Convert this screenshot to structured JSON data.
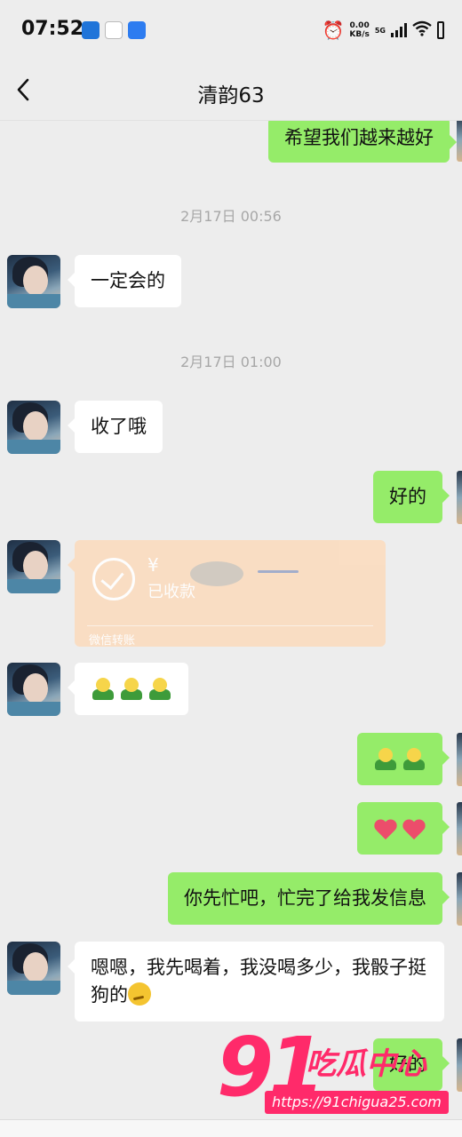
{
  "status_bar": {
    "time": "07:52",
    "net_speed_value": "0.00",
    "net_speed_unit": "KB/s",
    "network": "5G"
  },
  "nav": {
    "title": "清韵63"
  },
  "messages": {
    "m1": "希望我们越来越好",
    "stamp1": "2月17日 00:56",
    "m2": "一定会的",
    "stamp2": "2月17日 01:00",
    "m3": "收了哦",
    "m4": "好的",
    "transfer": {
      "amount": "¥",
      "status": "已收款",
      "footer": "微信转账"
    },
    "m9": "你先忙吧，忙完了给我发信息",
    "m10": "嗯嗯，我先喝着，我没喝多少，我骰子挺狗的",
    "m11": "好的"
  },
  "watermark": {
    "number": "91",
    "name": "吃瓜中心",
    "url": "https://91chigua25.com"
  },
  "colors": {
    "background": "#ededed",
    "bubble_out": "#95ec69",
    "bubble_in": "#ffffff",
    "watermark": "#ff2a6a"
  }
}
